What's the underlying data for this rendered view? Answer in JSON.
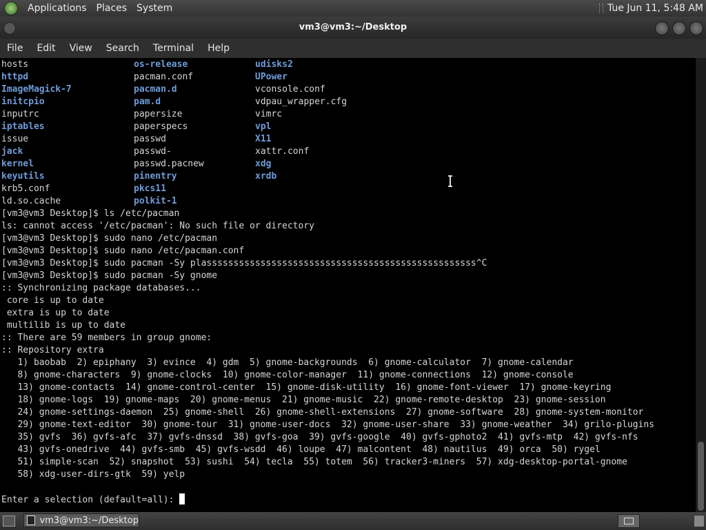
{
  "top_panel": {
    "menus": [
      "Applications",
      "Places",
      "System"
    ],
    "clock": "Tue Jun 11,  5:48 AM"
  },
  "window": {
    "title": "vm3@vm3:~/Desktop",
    "menubar": [
      "File",
      "Edit",
      "View",
      "Search",
      "Terminal",
      "Help"
    ]
  },
  "terminal": {
    "ls_rows": [
      [
        {
          "t": "hosts",
          "d": false
        },
        {
          "t": "os-release",
          "d": true
        },
        {
          "t": "udisks2",
          "d": true
        }
      ],
      [
        {
          "t": "httpd",
          "d": true
        },
        {
          "t": "pacman.conf",
          "d": false
        },
        {
          "t": "UPower",
          "d": true
        }
      ],
      [
        {
          "t": "ImageMagick-7",
          "d": true
        },
        {
          "t": "pacman.d",
          "d": true
        },
        {
          "t": "vconsole.conf",
          "d": false
        }
      ],
      [
        {
          "t": "initcpio",
          "d": true
        },
        {
          "t": "pam.d",
          "d": true
        },
        {
          "t": "vdpau_wrapper.cfg",
          "d": false
        }
      ],
      [
        {
          "t": "inputrc",
          "d": false
        },
        {
          "t": "papersize",
          "d": false
        },
        {
          "t": "vimrc",
          "d": false
        }
      ],
      [
        {
          "t": "iptables",
          "d": true
        },
        {
          "t": "paperspecs",
          "d": false
        },
        {
          "t": "vpl",
          "d": true
        }
      ],
      [
        {
          "t": "issue",
          "d": false
        },
        {
          "t": "passwd",
          "d": false
        },
        {
          "t": "X11",
          "d": true
        }
      ],
      [
        {
          "t": "jack",
          "d": true
        },
        {
          "t": "passwd-",
          "d": false
        },
        {
          "t": "xattr.conf",
          "d": false
        }
      ],
      [
        {
          "t": "kernel",
          "d": true
        },
        {
          "t": "passwd.pacnew",
          "d": false
        },
        {
          "t": "xdg",
          "d": true
        }
      ],
      [
        {
          "t": "keyutils",
          "d": true
        },
        {
          "t": "pinentry",
          "d": true
        },
        {
          "t": "xrdb",
          "d": true
        }
      ],
      [
        {
          "t": "krb5.conf",
          "d": false
        },
        {
          "t": "pkcs11",
          "d": true
        },
        {
          "t": "",
          "d": false
        }
      ],
      [
        {
          "t": "ld.so.cache",
          "d": false
        },
        {
          "t": "polkit-1",
          "d": true
        },
        {
          "t": "",
          "d": false
        }
      ]
    ],
    "lines": [
      "[vm3@vm3 Desktop]$ ls /etc/pacman",
      "ls: cannot access '/etc/pacman': No such file or directory",
      "[vm3@vm3 Desktop]$ sudo nano /etc/pacman",
      "[vm3@vm3 Desktop]$ sudo nano /etc/pacman.conf",
      "[vm3@vm3 Desktop]$ sudo pacman -Sy plassssssssssssssssssssssssssssssssssssssssssssssssss^C",
      "[vm3@vm3 Desktop]$ sudo pacman -Sy gnome",
      ":: Synchronizing package databases...",
      " core is up to date",
      " extra is up to date",
      " multilib is up to date",
      ":: There are 59 members in group gnome:",
      ":: Repository extra",
      "   1) baobab  2) epiphany  3) evince  4) gdm  5) gnome-backgrounds  6) gnome-calculator  7) gnome-calendar",
      "   8) gnome-characters  9) gnome-clocks  10) gnome-color-manager  11) gnome-connections  12) gnome-console",
      "   13) gnome-contacts  14) gnome-control-center  15) gnome-disk-utility  16) gnome-font-viewer  17) gnome-keyring",
      "   18) gnome-logs  19) gnome-maps  20) gnome-menus  21) gnome-music  22) gnome-remote-desktop  23) gnome-session",
      "   24) gnome-settings-daemon  25) gnome-shell  26) gnome-shell-extensions  27) gnome-software  28) gnome-system-monitor",
      "   29) gnome-text-editor  30) gnome-tour  31) gnome-user-docs  32) gnome-user-share  33) gnome-weather  34) grilo-plugins",
      "   35) gvfs  36) gvfs-afc  37) gvfs-dnssd  38) gvfs-goa  39) gvfs-google  40) gvfs-gphoto2  41) gvfs-mtp  42) gvfs-nfs",
      "   43) gvfs-onedrive  44) gvfs-smb  45) gvfs-wsdd  46) loupe  47) malcontent  48) nautilus  49) orca  50) rygel",
      "   51) simple-scan  52) snapshot  53) sushi  54) tecla  55) totem  56) tracker3-miners  57) xdg-desktop-portal-gnome",
      "   58) xdg-user-dirs-gtk  59) yelp",
      ""
    ],
    "prompt": "Enter a selection (default=all): "
  },
  "taskbar": {
    "task_label": "vm3@vm3:~/Desktop"
  }
}
